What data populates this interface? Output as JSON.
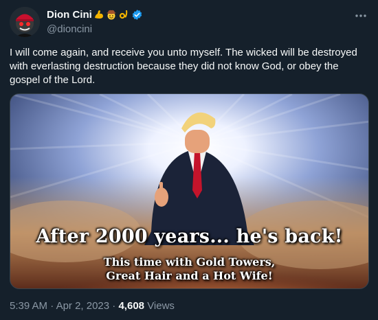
{
  "tweet": {
    "author": {
      "display_name": "Dion Cini",
      "handle": "@dioncini",
      "verified": true,
      "name_emojis": [
        "flexed-biceps-emoji",
        "cowboy-hat-face-emoji",
        "ok-hand-emoji"
      ]
    },
    "text": "I will come again, and receive you unto myself. The wicked will be destroyed with everlasting destruction because they did not know God, or obey the gospel of the Lord.",
    "media": {
      "caption_main": "After 2000 years... he's back!",
      "caption_line1": "This time with Gold Towers,",
      "caption_line2": "Great Hair and a Hot Wife!"
    },
    "meta": {
      "time": "5:39 AM",
      "separator": "·",
      "date": "Apr 2, 2023",
      "views_count": "4,608",
      "views_label": "Views"
    }
  },
  "colors": {
    "background": "#15202b",
    "text_primary": "#f7f9f9",
    "text_secondary": "#8b98a5",
    "verified_blue": "#1d9bf0",
    "border": "#38444d"
  }
}
